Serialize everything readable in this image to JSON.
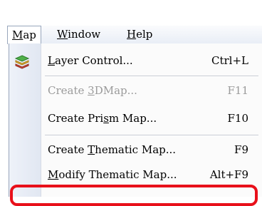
{
  "menubar": {
    "items": [
      {
        "pre": "",
        "acc": "M",
        "post": "ap"
      },
      {
        "pre": "",
        "acc": "W",
        "post": "indow"
      },
      {
        "pre": "",
        "acc": "H",
        "post": "elp"
      }
    ]
  },
  "menu": {
    "items": [
      {
        "pre": "",
        "acc": "L",
        "post": "ayer Control...",
        "shortcut": "Ctrl+L",
        "enabled": true,
        "icon": "layers-icon"
      },
      {
        "pre": "Create ",
        "acc": "3",
        "post": "DMap...",
        "shortcut": "F11",
        "enabled": false
      },
      {
        "pre": "Create Pri",
        "acc": "s",
        "post": "m Map...",
        "shortcut": "F10",
        "enabled": true
      },
      {
        "pre": "Create ",
        "acc": "T",
        "post": "hematic Map...",
        "shortcut": "F9",
        "enabled": true
      },
      {
        "pre": "",
        "acc": "M",
        "post": "odify Thematic Map...",
        "shortcut": "Alt+F9",
        "enabled": true
      }
    ]
  },
  "colors": {
    "highlight": "#e8101a",
    "menu_bg": "#fbfbfb",
    "menubar_bg": "#e9eef6"
  }
}
